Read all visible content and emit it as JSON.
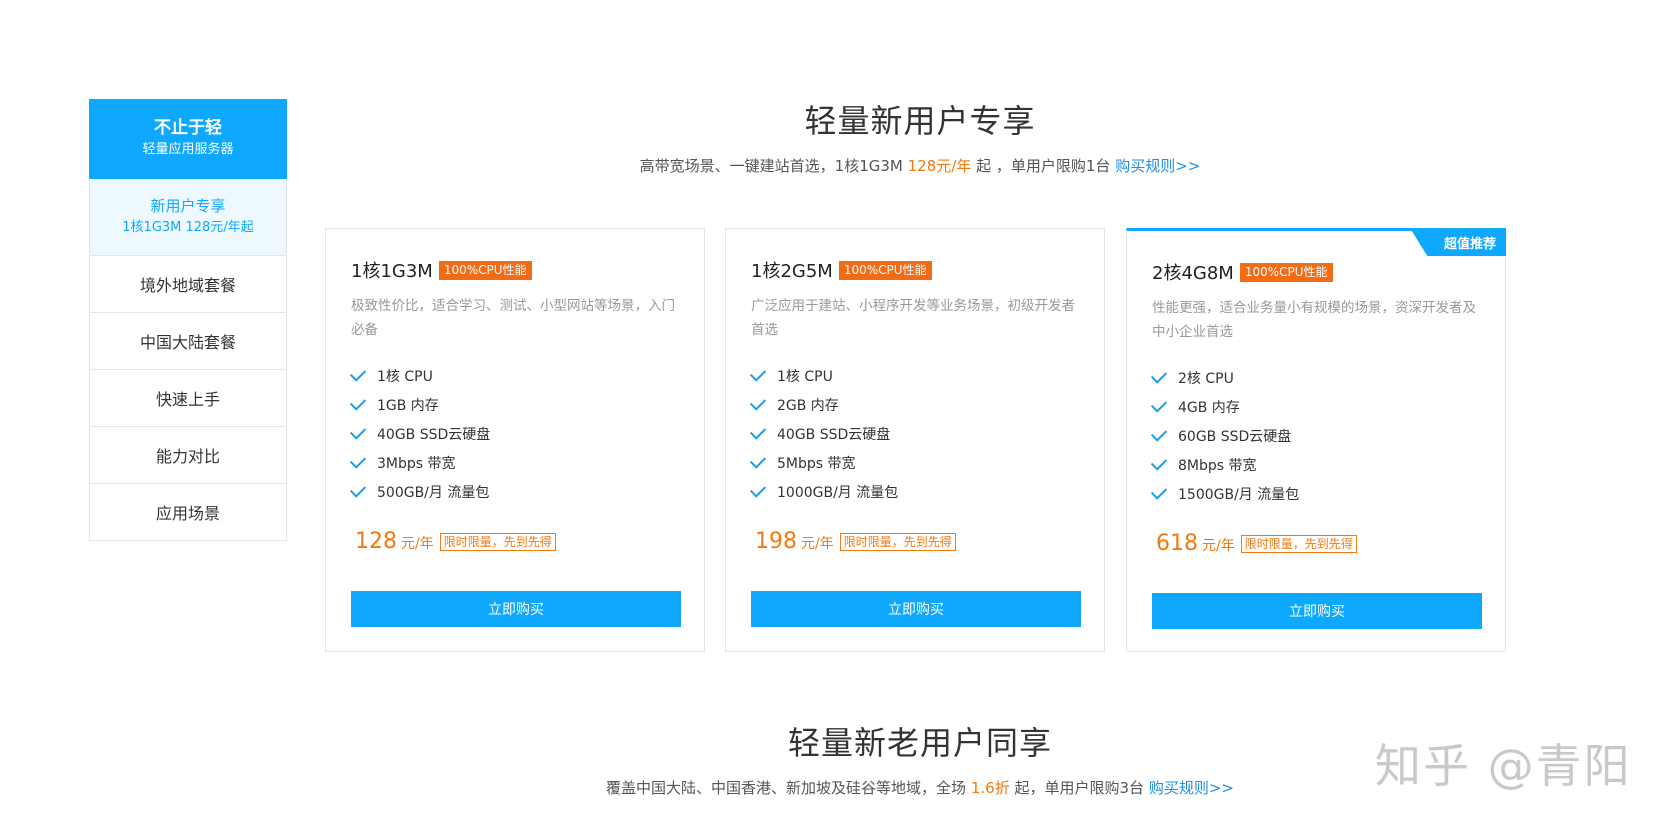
{
  "sidebar": {
    "header_title": "不止于轻",
    "header_subtitle": "轻量应用服务器",
    "active_item": {
      "label": "新用户专享",
      "sub": "1核1G3M 128元/年起"
    },
    "items": [
      "境外地域套餐",
      "中国大陆套餐",
      "快速上手",
      "能力对比",
      "应用场景"
    ]
  },
  "section1": {
    "title": "轻量新用户专享",
    "sub_a": "高带宽场景、一键建站首选，1核1G3M",
    "sub_price": "128元/年",
    "sub_b": "起 ，单用户限购1台",
    "sub_link": "购买规则>>"
  },
  "cards": [
    {
      "name": "1核1G3M",
      "tag": "100%CPU性能",
      "desc": "极致性价比，适合学习、测试、小型网站等场景，入门必备",
      "specs": [
        "1核 CPU",
        "1GB 内存",
        "40GB SSD云硬盘",
        "3Mbps 带宽",
        "500GB/月 流量包"
      ],
      "price": "128",
      "unit": "元/年",
      "limit": "限时限量，先到先得",
      "button": "立即购买"
    },
    {
      "name": "1核2G5M",
      "tag": "100%CPU性能",
      "desc": "广泛应用于建站、小程序开发等业务场景，初级开发者首选",
      "specs": [
        "1核 CPU",
        "2GB 内存",
        "40GB SSD云硬盘",
        "5Mbps 带宽",
        "1000GB/月 流量包"
      ],
      "price": "198",
      "unit": "元/年",
      "limit": "限时限量，先到先得",
      "button": "立即购买"
    },
    {
      "name": "2核4G8M",
      "tag": "100%CPU性能",
      "ribbon": "超值推荐",
      "desc": "性能更强，适合业务量小有规模的场景，资深开发者及中小企业首选",
      "specs": [
        "2核 CPU",
        "4GB 内存",
        "60GB SSD云硬盘",
        "8Mbps 带宽",
        "1500GB/月 流量包"
      ],
      "price": "618",
      "unit": "元/年",
      "limit": "限时限量，先到先得",
      "button": "立即购买"
    }
  ],
  "section2": {
    "title": "轻量新老用户同享",
    "sub_a": "覆盖中国大陆、中国香港、新加坡及硅谷等地域，全场",
    "sub_discount": "1.6折",
    "sub_b": "起，单用户限购3台",
    "sub_link": "购买规则>>"
  },
  "watermark": "知乎 @青阳",
  "colors": {
    "accent": "#0ea8ff",
    "price": "#f07a11",
    "tag": "#f26c16",
    "link": "#1e8ee8"
  }
}
